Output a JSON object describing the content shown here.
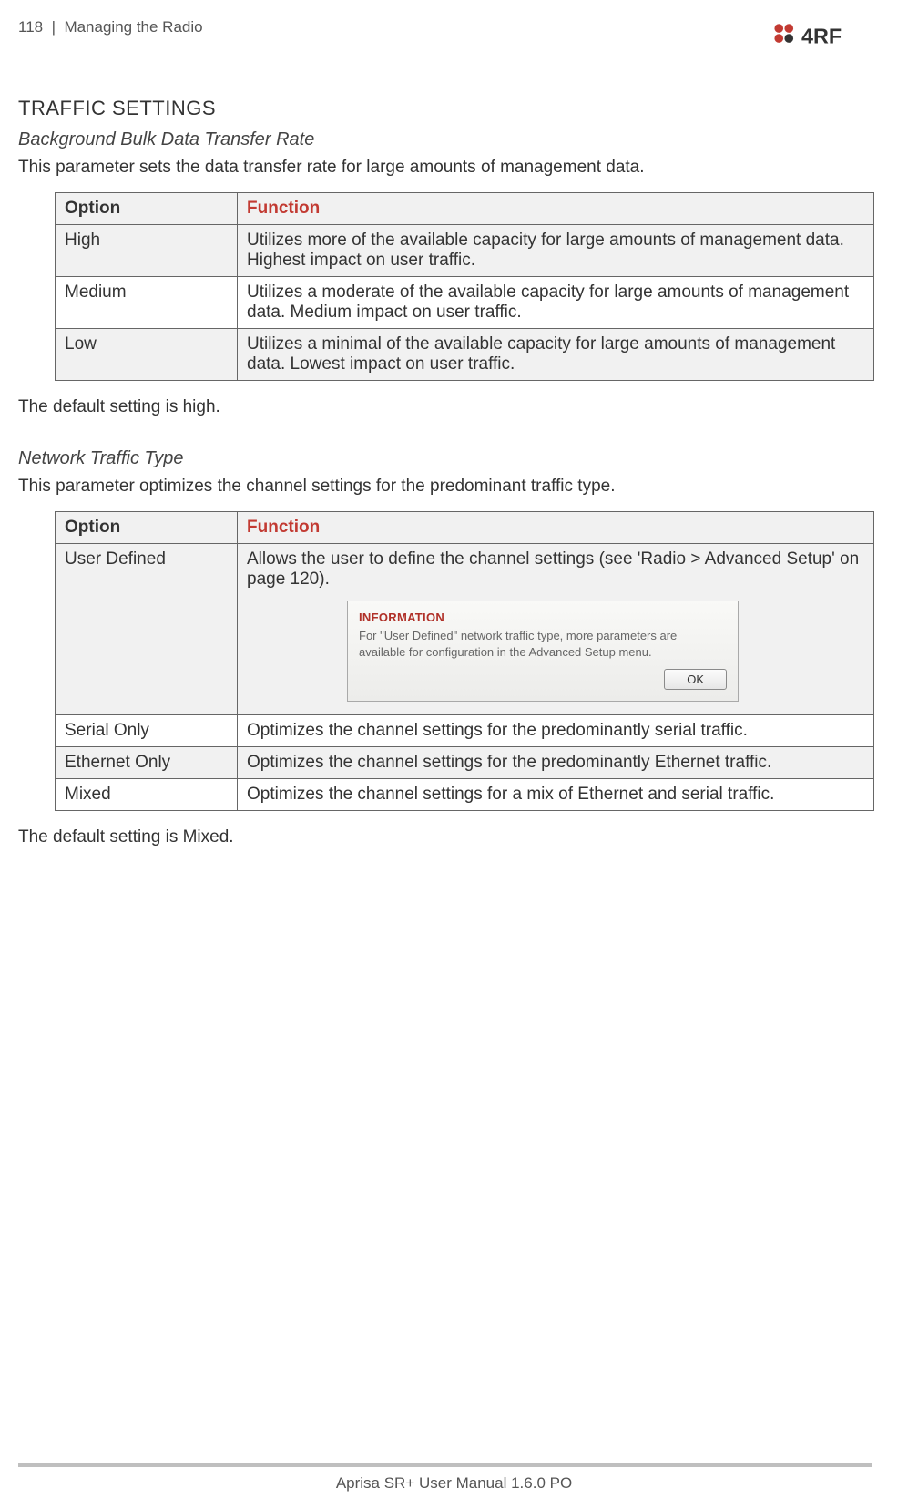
{
  "header": {
    "page_number": "118",
    "divider": "|",
    "chapter": "Managing the Radio",
    "logo_text": "4RF"
  },
  "section_title": "TRAFFIC SETTINGS",
  "subsection1": {
    "title": "Background Bulk Data Transfer Rate",
    "intro": "This parameter sets the data transfer rate for large amounts of management data.",
    "table_headers": {
      "col1": "Option",
      "col2": "Function"
    },
    "rows": [
      {
        "option": "High",
        "function": "Utilizes more of the available capacity for large amounts of management data. Highest impact on user traffic."
      },
      {
        "option": "Medium",
        "function": "Utilizes a moderate of the available capacity for large amounts of management data. Medium impact on user traffic."
      },
      {
        "option": "Low",
        "function": "Utilizes a minimal of the available capacity for large amounts of management data. Lowest impact on user traffic."
      }
    ],
    "default": "The default setting is high."
  },
  "subsection2": {
    "title": "Network Traffic Type",
    "intro": "This parameter optimizes the channel settings for the predominant traffic type.",
    "table_headers": {
      "col1": "Option",
      "col2": "Function"
    },
    "rows": [
      {
        "option": "User Defined",
        "function": "Allows the user to define the channel settings (see 'Radio > Advanced Setup' on page 120)."
      },
      {
        "option": "Serial Only",
        "function": "Optimizes the channel settings for the predominantly serial traffic."
      },
      {
        "option": "Ethernet Only",
        "function": "Optimizes the channel settings for the predominantly Ethernet traffic."
      },
      {
        "option": "Mixed",
        "function": "Optimizes the channel settings for a mix of Ethernet and serial traffic."
      }
    ],
    "info_dialog": {
      "title": "INFORMATION",
      "message": "For \"User Defined\" network traffic type, more parameters are available for configuration in the Advanced Setup menu.",
      "ok_label": "OK"
    },
    "default": "The default setting is Mixed."
  },
  "footer": {
    "text": "Aprisa SR+ User Manual 1.6.0 PO"
  }
}
